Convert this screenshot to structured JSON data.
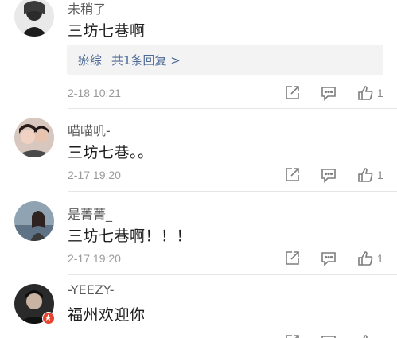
{
  "comments": [
    {
      "username": "未稍了",
      "text": "三坊七巷啊",
      "reply_author": "瘀综",
      "reply_summary": "共1条回复 >",
      "time": "2-18 10:21",
      "likes": "1",
      "icons": [
        "share-icon",
        "comment-icon",
        "like-icon"
      ]
    },
    {
      "username": "喵喵叽-",
      "text": "三坊七巷。。",
      "time": "2-17 19:20",
      "likes": "1",
      "icons": [
        "share-icon",
        "comment-icon",
        "like-icon"
      ]
    },
    {
      "username": "是菁菁_",
      "text": "三坊七巷啊！！！",
      "time": "2-17 19:20",
      "likes": "1",
      "icons": [
        "share-icon",
        "comment-icon",
        "like-icon"
      ]
    },
    {
      "username": "-YEEZY-",
      "text": "福州欢迎你",
      "time": "",
      "likes": "",
      "icons": [
        "share-icon",
        "comment-icon",
        "like-icon"
      ]
    }
  ],
  "colors": {
    "link": "#4d6a96",
    "meta": "#9a9a9a",
    "badge": "#e8432d",
    "reply_bg": "#f3f3f3"
  }
}
